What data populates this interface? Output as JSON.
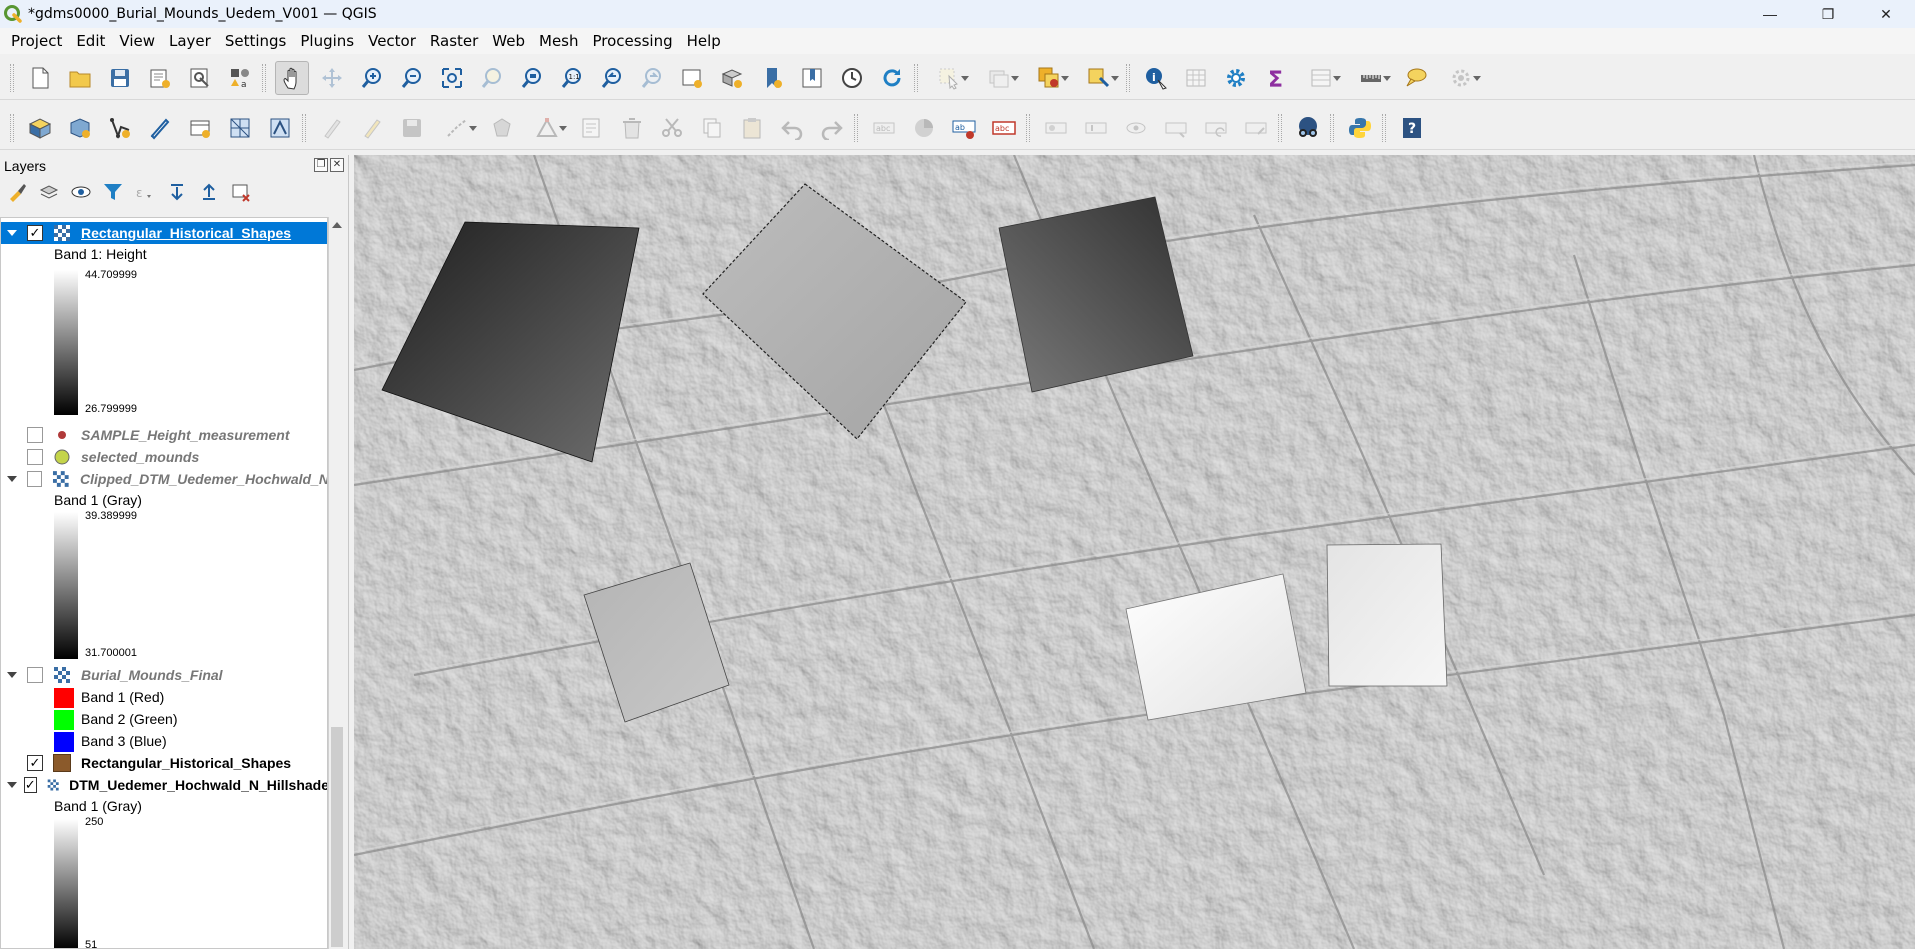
{
  "window": {
    "title": "*gdms0000_Burial_Mounds_Uedem_V001 — QGIS",
    "controls": {
      "minimize": "—",
      "restore": "❐",
      "close": "✕"
    }
  },
  "menu": [
    "Project",
    "Edit",
    "View",
    "Layer",
    "Settings",
    "Plugins",
    "Vector",
    "Raster",
    "Web",
    "Mesh",
    "Processing",
    "Help"
  ],
  "toolbar1": [
    {
      "name": "new-project",
      "state": "enabled"
    },
    {
      "name": "open-project",
      "state": "enabled"
    },
    {
      "name": "save-project",
      "state": "enabled"
    },
    {
      "name": "new-print-layout",
      "state": "enabled"
    },
    {
      "name": "layout-manager",
      "state": "enabled"
    },
    {
      "name": "style-manager",
      "state": "enabled"
    },
    {
      "name": "pan-map",
      "state": "active"
    },
    {
      "name": "pan-to-selection",
      "state": "disabled"
    },
    {
      "name": "zoom-in",
      "state": "enabled"
    },
    {
      "name": "zoom-out",
      "state": "enabled"
    },
    {
      "name": "zoom-full",
      "state": "enabled"
    },
    {
      "name": "zoom-to-selection",
      "state": "disabled"
    },
    {
      "name": "zoom-to-layer",
      "state": "enabled"
    },
    {
      "name": "zoom-native",
      "state": "enabled"
    },
    {
      "name": "zoom-last",
      "state": "enabled"
    },
    {
      "name": "zoom-next",
      "state": "disabled"
    },
    {
      "name": "new-map-view",
      "state": "enabled"
    },
    {
      "name": "new-3d-view",
      "state": "enabled"
    },
    {
      "name": "new-bookmark",
      "state": "enabled"
    },
    {
      "name": "show-bookmarks",
      "state": "enabled"
    },
    {
      "name": "temporal-controller",
      "state": "enabled"
    },
    {
      "name": "refresh",
      "state": "enabled"
    },
    {
      "name": "select-features",
      "state": "disabled"
    },
    {
      "name": "deselect-features",
      "state": "disabled"
    },
    {
      "name": "select-by-location",
      "state": "enabled"
    },
    {
      "name": "select-by-value",
      "state": "enabled"
    },
    {
      "name": "identify-features",
      "state": "enabled"
    },
    {
      "name": "open-attribute-table",
      "state": "disabled"
    },
    {
      "name": "processing-toolbox",
      "state": "enabled"
    },
    {
      "name": "statistical-summary",
      "state": "enabled"
    },
    {
      "name": "field-calculator",
      "state": "disabled"
    },
    {
      "name": "measure-line",
      "state": "enabled"
    },
    {
      "name": "show-map-tips",
      "state": "enabled"
    },
    {
      "name": "gps-tools",
      "state": "disabled"
    }
  ],
  "toolbar2": [
    {
      "name": "data-source-manager",
      "state": "enabled"
    },
    {
      "name": "new-geopackage-layer",
      "state": "enabled"
    },
    {
      "name": "new-shapefile-layer",
      "state": "enabled"
    },
    {
      "name": "digitizing-pen",
      "state": "enabled"
    },
    {
      "name": "new-virtual-layer",
      "state": "enabled"
    },
    {
      "name": "new-mesh-layer",
      "state": "enabled"
    },
    {
      "name": "new-vector-tile-layer",
      "state": "enabled"
    },
    {
      "name": "current-edits",
      "state": "disabled"
    },
    {
      "name": "toggle-editing",
      "state": "disabled"
    },
    {
      "name": "save-layer-edits",
      "state": "disabled"
    },
    {
      "name": "digitize-line",
      "state": "disabled"
    },
    {
      "name": "add-polygon",
      "state": "disabled"
    },
    {
      "name": "vertex-tool",
      "state": "disabled"
    },
    {
      "name": "modify-attributes",
      "state": "disabled"
    },
    {
      "name": "delete-selected",
      "state": "disabled"
    },
    {
      "name": "cut-features",
      "state": "disabled"
    },
    {
      "name": "copy-features",
      "state": "disabled"
    },
    {
      "name": "paste-features",
      "state": "disabled"
    },
    {
      "name": "undo",
      "state": "disabled"
    },
    {
      "name": "redo",
      "state": "disabled"
    },
    {
      "name": "label-tool",
      "state": "disabled"
    },
    {
      "name": "diagram-tool",
      "state": "disabled"
    },
    {
      "name": "layer-labeling-options",
      "state": "enabled"
    },
    {
      "name": "layer-diagram-options",
      "state": "enabled"
    },
    {
      "name": "highlight-pinned-labels",
      "state": "disabled"
    },
    {
      "name": "pin-unpin-labels",
      "state": "disabled"
    },
    {
      "name": "show-hide-labels",
      "state": "disabled"
    },
    {
      "name": "move-label",
      "state": "disabled"
    },
    {
      "name": "rotate-label",
      "state": "disabled"
    },
    {
      "name": "change-label",
      "state": "disabled"
    },
    {
      "name": "plugin-tool",
      "state": "enabled"
    },
    {
      "name": "python-console",
      "state": "enabled"
    },
    {
      "name": "help-contents",
      "state": "enabled"
    }
  ],
  "layers_panel": {
    "title": "Layers",
    "layer1": {
      "name": "Rectangular_Historical_Shapes",
      "checked": true,
      "selected": true,
      "band": "Band 1: Height",
      "max": "44.709999",
      "min": "26.799999"
    },
    "layer2": {
      "name": "SAMPLE_Height_measurement",
      "checked": false
    },
    "layer3": {
      "name": "selected_mounds",
      "checked": false
    },
    "layer4": {
      "name": "Clipped_DTM_Uedemer_Hochwald_N",
      "checked": false,
      "band": "Band 1 (Gray)",
      "max": "39.389999",
      "min": "31.700001"
    },
    "layer5": {
      "name": "Burial_Mounds_Final",
      "checked": false,
      "bands": [
        "Band 1 (Red)",
        "Band 2 (Green)",
        "Band 3 (Blue)"
      ],
      "band_colors": [
        "#ff0000",
        "#00ff00",
        "#0000ff"
      ]
    },
    "layer6": {
      "name": "Rectangular_Historical_Shapes",
      "checked": true,
      "fill": "#8b5a2b"
    },
    "layer7": {
      "name": "DTM_Uedemer_Hochwald_N_Hillshade",
      "checked": true,
      "band": "Band 1 (Gray)",
      "max": "250",
      "min": "51"
    }
  },
  "colors": {
    "selection": "#0078d7",
    "hillshade": "#a9a9a9"
  }
}
